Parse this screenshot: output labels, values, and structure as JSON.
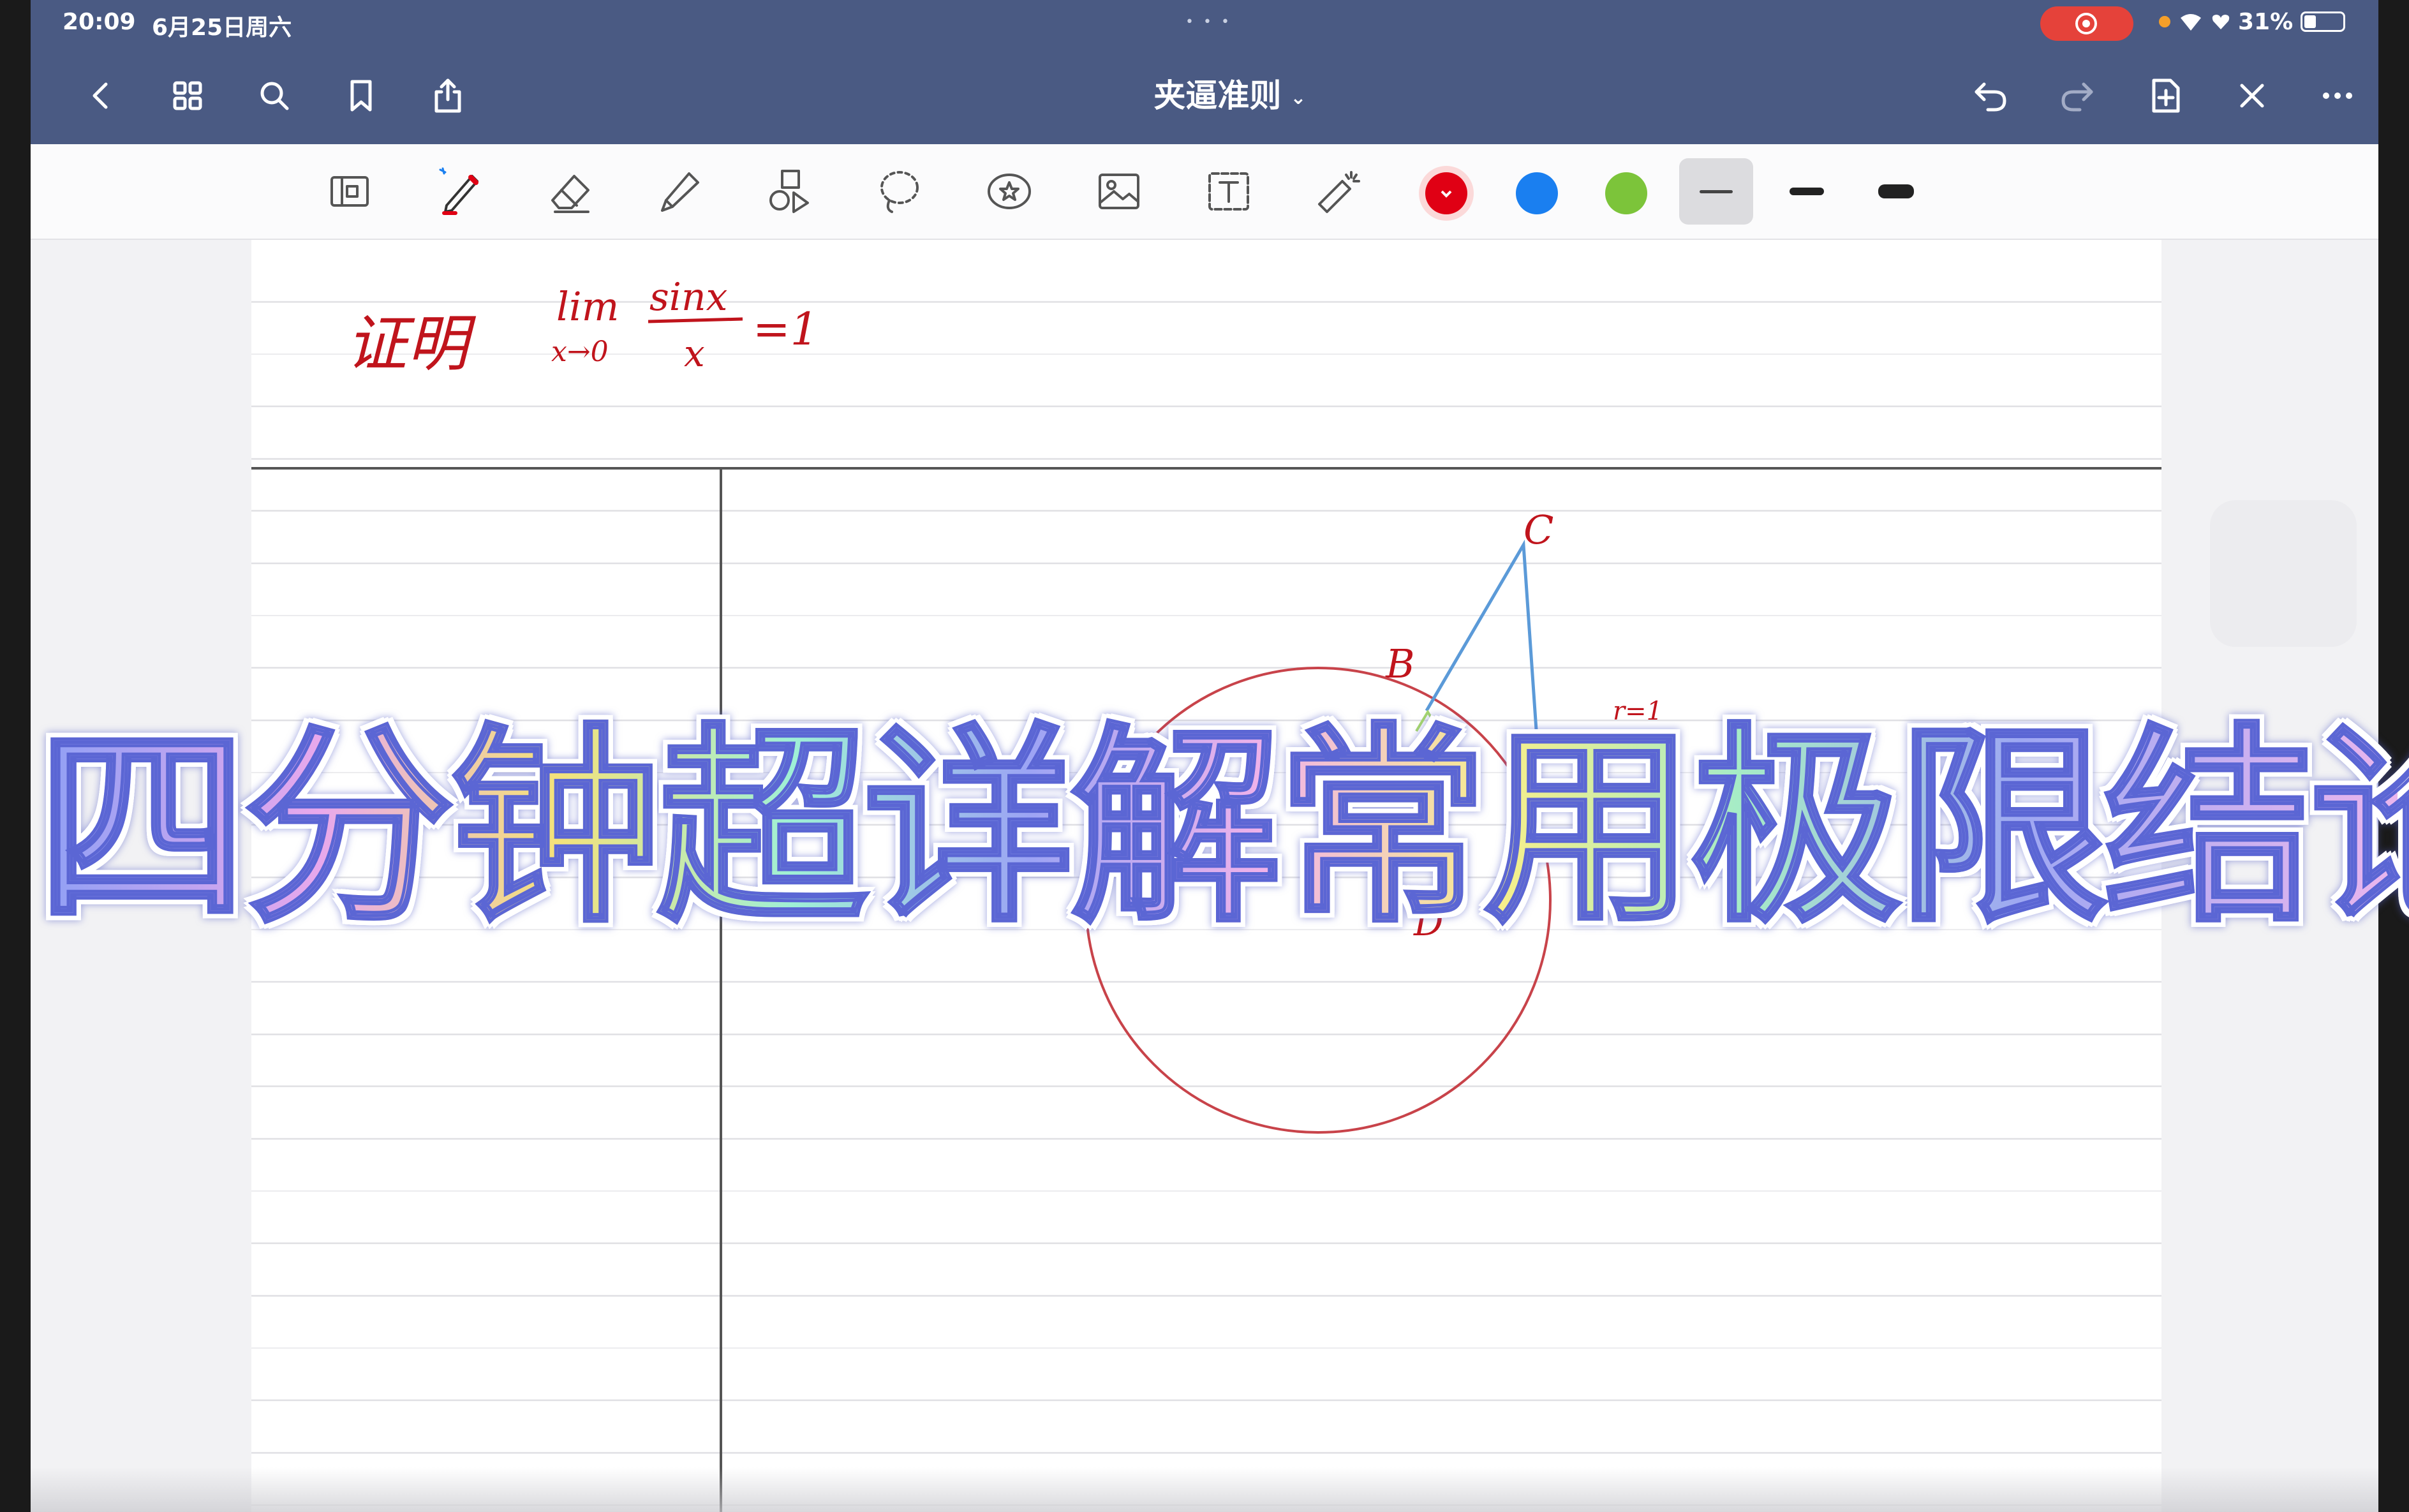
{
  "status": {
    "time": "20:09",
    "date": "6月25日周六",
    "battery": "31%",
    "battery_level": 0.31
  },
  "nav": {
    "title": "夹逼准则",
    "icons": [
      "back-icon",
      "grid-icon",
      "search-icon",
      "bookmark-icon",
      "share-icon",
      "undo-icon",
      "redo-icon",
      "add-page-icon",
      "close-icon",
      "more-icon"
    ]
  },
  "toolbar": {
    "tools": [
      "page-view-icon",
      "pen-icon",
      "eraser-icon",
      "highlighter-icon",
      "shapes-icon",
      "lasso-icon",
      "sticker-icon",
      "image-icon",
      "text-icon",
      "laser-pointer-icon"
    ],
    "colors": [
      "#e00014",
      "#1a7ff0",
      "#7cc43a"
    ],
    "selected_color": "#e00014",
    "stroke_widths": [
      "thin",
      "medium",
      "thick"
    ],
    "selected_stroke": "thin"
  },
  "note": {
    "proof_label": "证明",
    "lim": "lim",
    "lim_sub": "x→0",
    "numerator": "sinx",
    "denominator": "x",
    "equals": "=1",
    "point_c": "C",
    "point_b": "B",
    "point_d": "D",
    "radius_label": "r=1"
  },
  "overlay_title": "四分钟超详解常用极限结论"
}
